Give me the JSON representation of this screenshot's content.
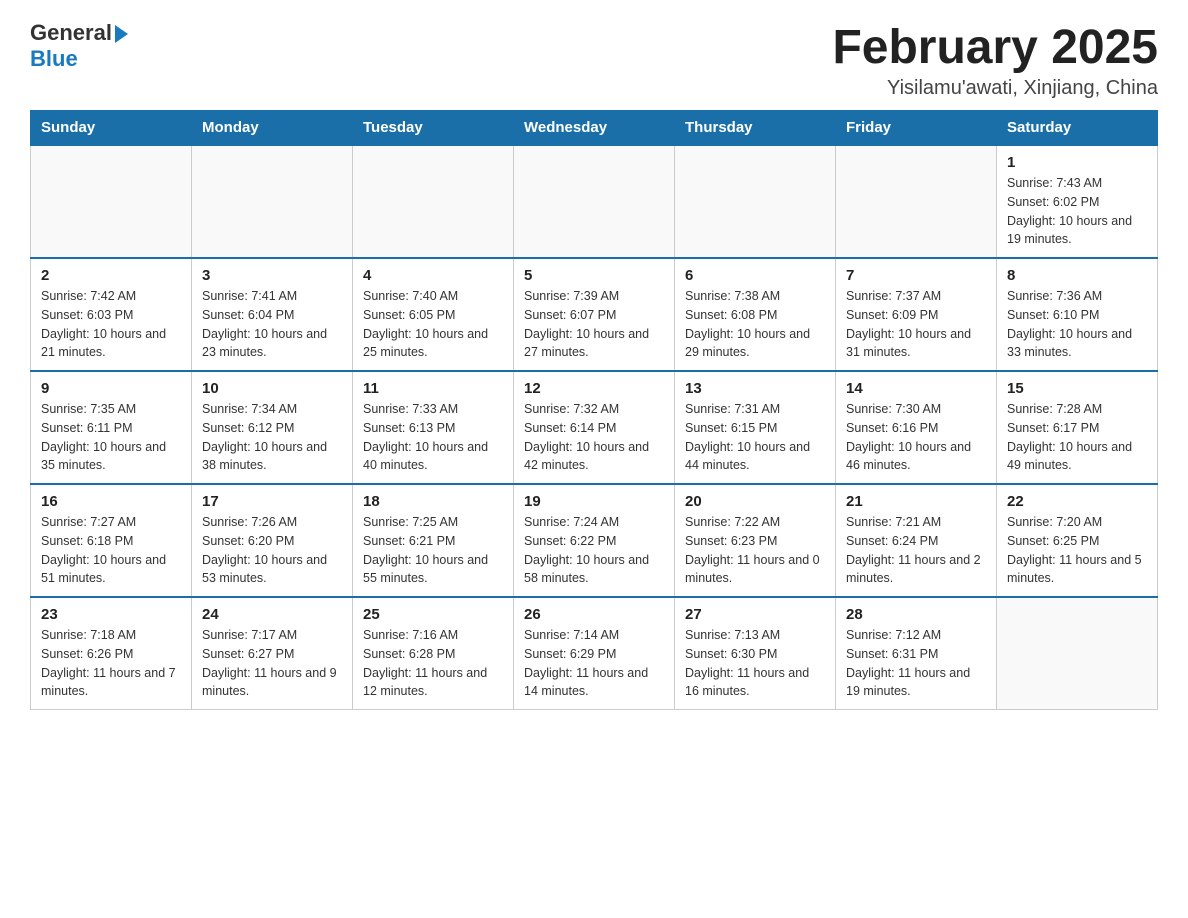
{
  "header": {
    "logo": {
      "general": "General",
      "blue": "Blue"
    },
    "title": "February 2025",
    "location": "Yisilamu'awati, Xinjiang, China"
  },
  "days_of_week": [
    "Sunday",
    "Monday",
    "Tuesday",
    "Wednesday",
    "Thursday",
    "Friday",
    "Saturday"
  ],
  "weeks": [
    [
      {
        "day": "",
        "info": ""
      },
      {
        "day": "",
        "info": ""
      },
      {
        "day": "",
        "info": ""
      },
      {
        "day": "",
        "info": ""
      },
      {
        "day": "",
        "info": ""
      },
      {
        "day": "",
        "info": ""
      },
      {
        "day": "1",
        "info": "Sunrise: 7:43 AM\nSunset: 6:02 PM\nDaylight: 10 hours and 19 minutes."
      }
    ],
    [
      {
        "day": "2",
        "info": "Sunrise: 7:42 AM\nSunset: 6:03 PM\nDaylight: 10 hours and 21 minutes."
      },
      {
        "day": "3",
        "info": "Sunrise: 7:41 AM\nSunset: 6:04 PM\nDaylight: 10 hours and 23 minutes."
      },
      {
        "day": "4",
        "info": "Sunrise: 7:40 AM\nSunset: 6:05 PM\nDaylight: 10 hours and 25 minutes."
      },
      {
        "day": "5",
        "info": "Sunrise: 7:39 AM\nSunset: 6:07 PM\nDaylight: 10 hours and 27 minutes."
      },
      {
        "day": "6",
        "info": "Sunrise: 7:38 AM\nSunset: 6:08 PM\nDaylight: 10 hours and 29 minutes."
      },
      {
        "day": "7",
        "info": "Sunrise: 7:37 AM\nSunset: 6:09 PM\nDaylight: 10 hours and 31 minutes."
      },
      {
        "day": "8",
        "info": "Sunrise: 7:36 AM\nSunset: 6:10 PM\nDaylight: 10 hours and 33 minutes."
      }
    ],
    [
      {
        "day": "9",
        "info": "Sunrise: 7:35 AM\nSunset: 6:11 PM\nDaylight: 10 hours and 35 minutes."
      },
      {
        "day": "10",
        "info": "Sunrise: 7:34 AM\nSunset: 6:12 PM\nDaylight: 10 hours and 38 minutes."
      },
      {
        "day": "11",
        "info": "Sunrise: 7:33 AM\nSunset: 6:13 PM\nDaylight: 10 hours and 40 minutes."
      },
      {
        "day": "12",
        "info": "Sunrise: 7:32 AM\nSunset: 6:14 PM\nDaylight: 10 hours and 42 minutes."
      },
      {
        "day": "13",
        "info": "Sunrise: 7:31 AM\nSunset: 6:15 PM\nDaylight: 10 hours and 44 minutes."
      },
      {
        "day": "14",
        "info": "Sunrise: 7:30 AM\nSunset: 6:16 PM\nDaylight: 10 hours and 46 minutes."
      },
      {
        "day": "15",
        "info": "Sunrise: 7:28 AM\nSunset: 6:17 PM\nDaylight: 10 hours and 49 minutes."
      }
    ],
    [
      {
        "day": "16",
        "info": "Sunrise: 7:27 AM\nSunset: 6:18 PM\nDaylight: 10 hours and 51 minutes."
      },
      {
        "day": "17",
        "info": "Sunrise: 7:26 AM\nSunset: 6:20 PM\nDaylight: 10 hours and 53 minutes."
      },
      {
        "day": "18",
        "info": "Sunrise: 7:25 AM\nSunset: 6:21 PM\nDaylight: 10 hours and 55 minutes."
      },
      {
        "day": "19",
        "info": "Sunrise: 7:24 AM\nSunset: 6:22 PM\nDaylight: 10 hours and 58 minutes."
      },
      {
        "day": "20",
        "info": "Sunrise: 7:22 AM\nSunset: 6:23 PM\nDaylight: 11 hours and 0 minutes."
      },
      {
        "day": "21",
        "info": "Sunrise: 7:21 AM\nSunset: 6:24 PM\nDaylight: 11 hours and 2 minutes."
      },
      {
        "day": "22",
        "info": "Sunrise: 7:20 AM\nSunset: 6:25 PM\nDaylight: 11 hours and 5 minutes."
      }
    ],
    [
      {
        "day": "23",
        "info": "Sunrise: 7:18 AM\nSunset: 6:26 PM\nDaylight: 11 hours and 7 minutes."
      },
      {
        "day": "24",
        "info": "Sunrise: 7:17 AM\nSunset: 6:27 PM\nDaylight: 11 hours and 9 minutes."
      },
      {
        "day": "25",
        "info": "Sunrise: 7:16 AM\nSunset: 6:28 PM\nDaylight: 11 hours and 12 minutes."
      },
      {
        "day": "26",
        "info": "Sunrise: 7:14 AM\nSunset: 6:29 PM\nDaylight: 11 hours and 14 minutes."
      },
      {
        "day": "27",
        "info": "Sunrise: 7:13 AM\nSunset: 6:30 PM\nDaylight: 11 hours and 16 minutes."
      },
      {
        "day": "28",
        "info": "Sunrise: 7:12 AM\nSunset: 6:31 PM\nDaylight: 11 hours and 19 minutes."
      },
      {
        "day": "",
        "info": ""
      }
    ]
  ]
}
